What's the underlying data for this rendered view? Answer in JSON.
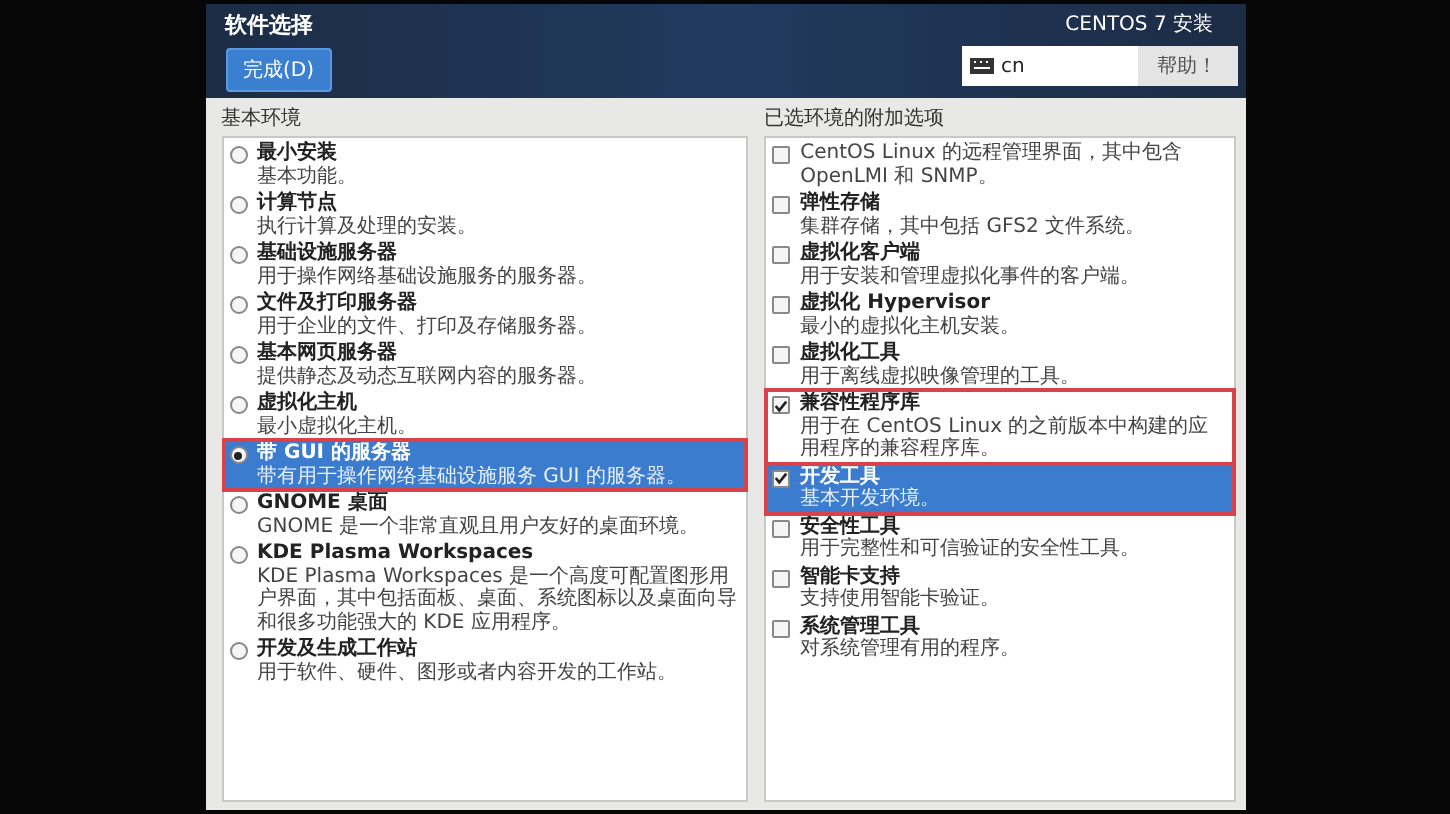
{
  "header": {
    "title": "软件选择",
    "done_button": "完成(D)",
    "product": "CENTOS 7 安装",
    "keyboard": {
      "value": "cn"
    },
    "help_button": "帮助！"
  },
  "base_environment": {
    "heading": "基本环境",
    "items": [
      {
        "name": "最小安装",
        "description": "基本功能。",
        "selected": false,
        "highlighted": false
      },
      {
        "name": "计算节点",
        "description": "执行计算及处理的安装。",
        "selected": false,
        "highlighted": false
      },
      {
        "name": "基础设施服务器",
        "description": "用于操作网络基础设施服务的服务器。",
        "selected": false,
        "highlighted": false
      },
      {
        "name": "文件及打印服务器",
        "description": "用于企业的文件、打印及存储服务器。",
        "selected": false,
        "highlighted": false
      },
      {
        "name": "基本网页服务器",
        "description": "提供静态及动态互联网内容的服务器。",
        "selected": false,
        "highlighted": false
      },
      {
        "name": "虚拟化主机",
        "description": "最小虚拟化主机。",
        "selected": false,
        "highlighted": false
      },
      {
        "name": "带 GUI 的服务器",
        "description": "带有用于操作网络基础设施服务 GUI 的服务器。",
        "selected": true,
        "highlighted": true
      },
      {
        "name": "GNOME 桌面",
        "description": "GNOME 是一个非常直观且用户友好的桌面环境。",
        "selected": false,
        "highlighted": false
      },
      {
        "name": "KDE Plasma Workspaces",
        "description": "KDE Plasma Workspaces 是一个高度可配置图形用户界面，其中包括面板、桌面、系统图标以及桌面向导和很多功能强大的 KDE 应用程序。",
        "selected": false,
        "highlighted": false
      },
      {
        "name": "开发及生成工作站",
        "description": "用于软件、硬件、图形或者内容开发的工作站。",
        "selected": false,
        "highlighted": false
      }
    ]
  },
  "addons": {
    "heading": "已选环境的附加选项",
    "items": [
      {
        "description": "CentOS Linux 的远程管理界面，其中包含 OpenLMI 和 SNMP。",
        "checked": false,
        "selected": false,
        "highlighted": false
      },
      {
        "name": "弹性存储",
        "description": "集群存储，其中包括 GFS2 文件系统。",
        "checked": false,
        "selected": false,
        "highlighted": false
      },
      {
        "name": "虚拟化客户端",
        "description": "用于安装和管理虚拟化事件的客户端。",
        "checked": false,
        "selected": false,
        "highlighted": false
      },
      {
        "name": "虚拟化 Hypervisor",
        "description": "最小的虚拟化主机安装。",
        "checked": false,
        "selected": false,
        "highlighted": false
      },
      {
        "name": "虚拟化工具",
        "description": "用于离线虚拟映像管理的工具。",
        "checked": false,
        "selected": false,
        "highlighted": false
      },
      {
        "name": "兼容性程序库",
        "description": "用于在 CentOS Linux 的之前版本中构建的应用程序的兼容程序库。",
        "checked": true,
        "selected": false,
        "highlighted": true
      },
      {
        "name": "开发工具",
        "description": "基本开发环境。",
        "checked": true,
        "selected": true,
        "highlighted": true
      },
      {
        "name": "安全性工具",
        "description": "用于完整性和可信验证的安全性工具。",
        "checked": false,
        "selected": false,
        "highlighted": false
      },
      {
        "name": "智能卡支持",
        "description": "支持使用智能卡验证。",
        "checked": false,
        "selected": false,
        "highlighted": false
      },
      {
        "name": "系统管理工具",
        "description": "对系统管理有用的程序。",
        "checked": false,
        "selected": false,
        "highlighted": false
      }
    ]
  }
}
